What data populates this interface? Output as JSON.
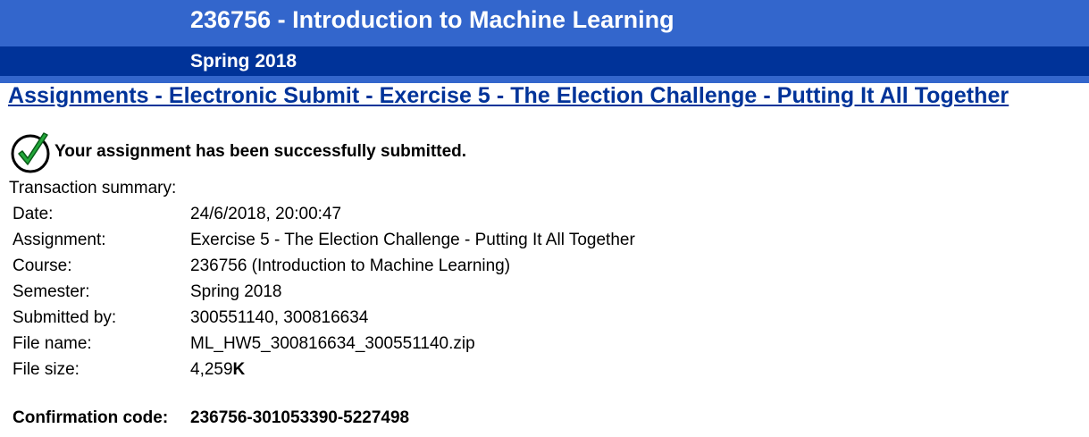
{
  "header": {
    "course_title": "236756 - Introduction to Machine Learning",
    "semester": "Spring 2018",
    "colors": {
      "header_top": "#3366cc",
      "header_bottom": "#003399",
      "heading_text": "#003399"
    }
  },
  "page_heading": "Assignments - Electronic Submit - Exercise 5 - The Election Challenge - Putting It All Together",
  "status": {
    "icon": "checkmark-icon",
    "message": "Your assignment has been successfully submitted."
  },
  "summary": {
    "caption": "Transaction summary:",
    "rows": [
      {
        "label": "Date:",
        "value": "24/6/2018, 20:00:47"
      },
      {
        "label": "Assignment:",
        "value": "Exercise 5 - The Election Challenge - Putting It All Together"
      },
      {
        "label": "Course:",
        "value": "236756 (Introduction to Machine Learning)"
      },
      {
        "label": "Semester:",
        "value": "Spring 2018"
      },
      {
        "label": "Submitted by:",
        "value": "300551140, 300816634"
      },
      {
        "label": "File name:",
        "value": "ML_HW5_300816634_300551140.zip"
      },
      {
        "label": "File size:",
        "value": "4,259",
        "unit": "K"
      }
    ]
  },
  "confirmation": {
    "label": "Confirmation code:",
    "code": "236756-301053390-5227498"
  }
}
